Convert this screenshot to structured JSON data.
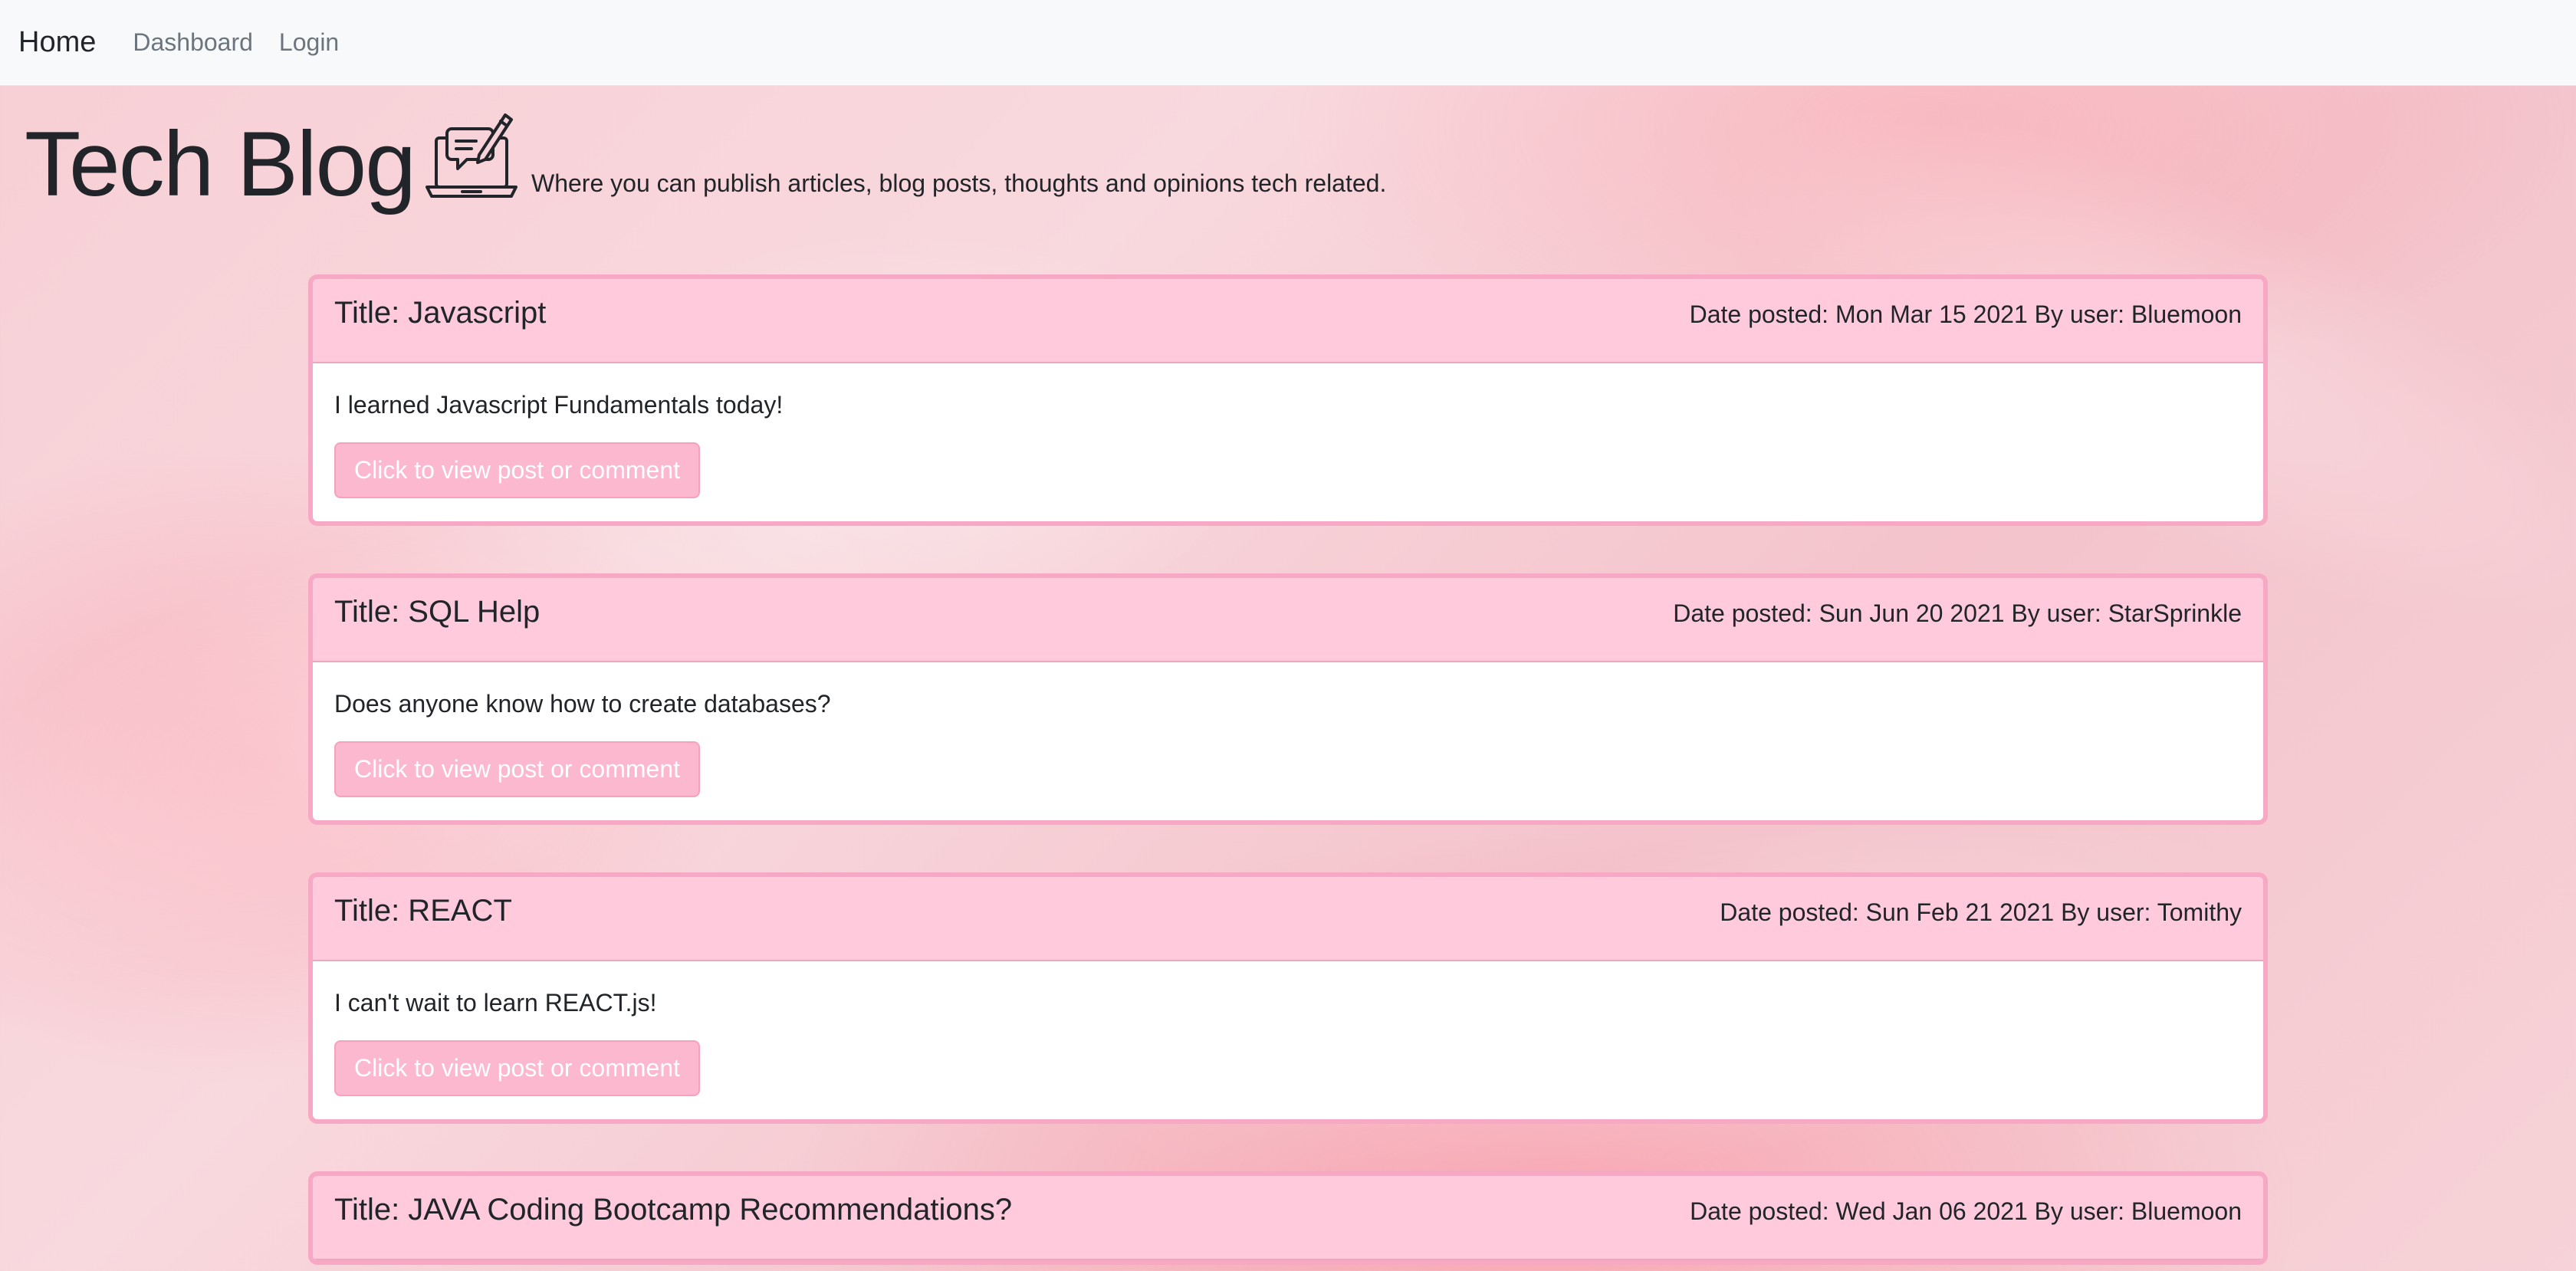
{
  "nav": {
    "brand": "Home",
    "links": [
      "Dashboard",
      "Login"
    ]
  },
  "header": {
    "title": "Tech Blog",
    "logo_icon": "laptop-chat-pen-icon",
    "tagline": "Where you can publish articles, blog posts, thoughts and opinions tech related."
  },
  "posts": [
    {
      "title": "Title: Javascript",
      "meta": "Date posted: Mon Mar 15 2021 By user: Bluemoon",
      "body": "I learned Javascript Fundamentals today!",
      "button": "Click to view post or comment"
    },
    {
      "title": "Title: SQL Help",
      "meta": "Date posted: Sun Jun 20 2021 By user: StarSprinkle",
      "body": "Does anyone know how to create databases?",
      "button": "Click to view post or comment"
    },
    {
      "title": "Title: REACT",
      "meta": "Date posted: Sun Feb 21 2021 By user: Tomithy",
      "body": "I can't wait to learn REACT.js!",
      "button": "Click to view post or comment"
    },
    {
      "title": "Title: JAVA Coding Bootcamp Recommendations?",
      "meta": "Date posted: Wed Jan 06 2021 By user: Bluemoon",
      "body": "",
      "button": ""
    }
  ],
  "colors": {
    "card_border": "#f7a8c4",
    "card_header": "#ffcadb",
    "button_bg": "#fbb8cf",
    "navbar_bg": "#f8f9fa"
  }
}
